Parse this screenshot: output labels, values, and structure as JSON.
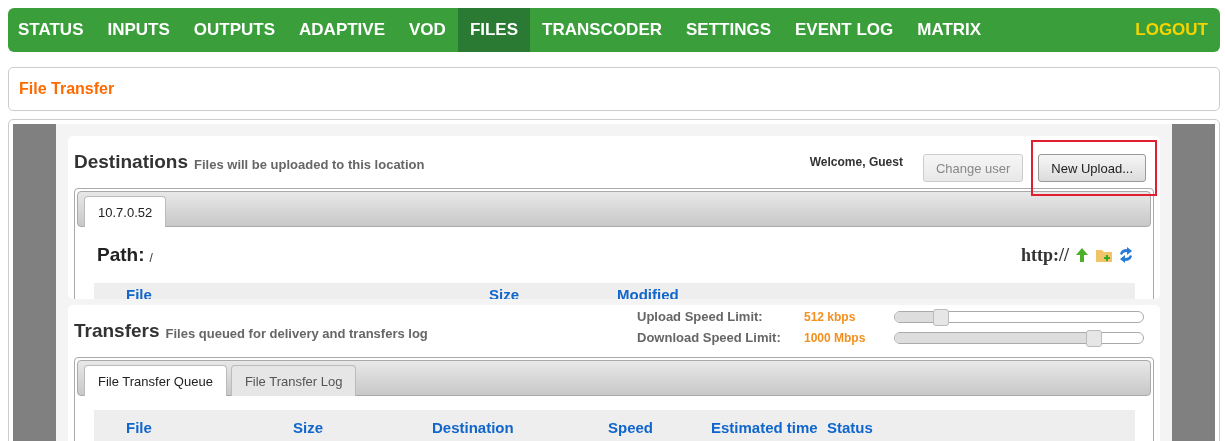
{
  "nav": {
    "items": [
      {
        "label": "STATUS",
        "selected": false
      },
      {
        "label": "INPUTS",
        "selected": false
      },
      {
        "label": "OUTPUTS",
        "selected": false
      },
      {
        "label": "ADAPTIVE",
        "selected": false
      },
      {
        "label": "VOD",
        "selected": false
      },
      {
        "label": "FILES",
        "selected": true
      },
      {
        "label": "TRANSCODER",
        "selected": false
      },
      {
        "label": "SETTINGS",
        "selected": false
      },
      {
        "label": "EVENT LOG",
        "selected": false
      },
      {
        "label": "MATRIX",
        "selected": false
      }
    ],
    "logout": "LOGOUT"
  },
  "page_title": "File Transfer",
  "destinations": {
    "title": "Destinations",
    "subtitle": "Files will be uploaded to this location",
    "welcome": "Welcome, Guest",
    "buttons": [
      {
        "label": "Change user",
        "disabled": true,
        "highlighted": false
      },
      {
        "label": "New Upload...",
        "disabled": false,
        "highlighted": true
      }
    ],
    "tabs": [
      {
        "label": "10.7.0.52",
        "selected": true
      }
    ],
    "path_label": "Path:",
    "path": "/",
    "url_prefix": "http://",
    "columns": [
      "File",
      "Size",
      "Modified"
    ]
  },
  "transfers": {
    "title": "Transfers",
    "subtitle": "Files queued for delivery and transfers log",
    "limits": [
      {
        "label": "Upload Speed Limit:",
        "reading": "512 kbps",
        "level": 0.18
      },
      {
        "label": "Download Speed Limit:",
        "reading": "1000 Mbps",
        "level": 0.8
      }
    ],
    "tabs": [
      {
        "label": "File Transfer Queue",
        "selected": true
      },
      {
        "label": "File Transfer Log",
        "selected": false
      }
    ],
    "columns": [
      "File",
      "Size",
      "Destination",
      "Speed",
      "Estimated time",
      "Status"
    ]
  }
}
